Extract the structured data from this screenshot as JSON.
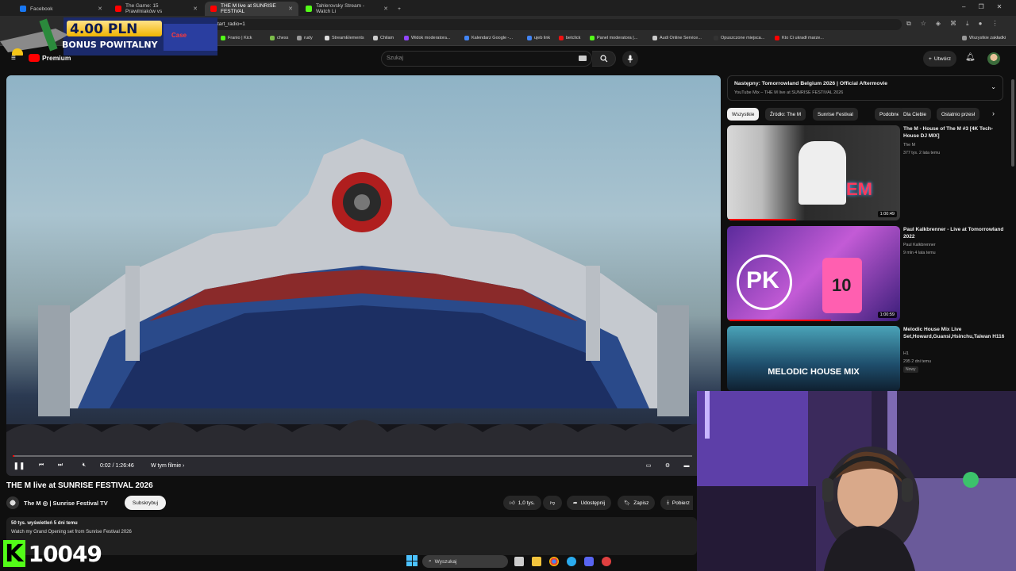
{
  "browser": {
    "tabs": [
      {
        "label": "Facebook",
        "favicon_color": "#1877f2"
      },
      {
        "label": "The Game: 15 Prawilniaków vs",
        "favicon_color": "#ff0000"
      },
      {
        "label": "THE M live at SUNRISE FESTIVAL",
        "favicon_color": "#ff0000"
      },
      {
        "label": "Tahlerovsky Stream - Watch Li",
        "favicon_color": "#53fc18"
      }
    ],
    "new_tab_label": "+",
    "address": "tart_radio=1",
    "bookmarks": [
      {
        "label": "Franio | Kick",
        "color": "#53fc18"
      },
      {
        "label": "chess",
        "color": "#7cbd4a"
      },
      {
        "label": "rudy",
        "color": "#999999"
      },
      {
        "label": "StreamElements",
        "color": "#dddddd"
      },
      {
        "label": "Chilam",
        "color": "#cccccc"
      },
      {
        "label": "Widok moderatora...",
        "color": "#9146ff"
      },
      {
        "label": "Kalendarz Google -...",
        "color": "#4285f4"
      },
      {
        "label": "ujeb link",
        "color": "#4285f4"
      },
      {
        "label": "betclick",
        "color": "#e11"
      },
      {
        "label": "Panel moderatora |...",
        "color": "#53fc18"
      },
      {
        "label": "Audi Online Service...",
        "color": "#cccccc"
      },
      {
        "label": "Opuszczone miejsca...",
        "color": "#333333"
      },
      {
        "label": "Kto Ci ukradł marze...",
        "color": "#ff0000"
      }
    ],
    "all_bookmarks": "Wszystkie zakładki"
  },
  "promo": {
    "amount": "4.00 PLN",
    "subtitle": "BONUS POWITALNY",
    "brand": "Case"
  },
  "youtube": {
    "logo_text": "Premium",
    "search_placeholder": "Szukaj",
    "create_label": "Utwórz"
  },
  "player": {
    "time": "0:02 / 1:26:46",
    "chapter": "W tym filmie",
    "progress": 0.0004
  },
  "video": {
    "title": "THE M live at SUNRISE FESTIVAL 2026",
    "channel": "The M ◎ | Sunrise Festival TV",
    "subscribe": "Subskrybuj",
    "likes": "1,0 tys.",
    "share": "Udostępnij",
    "save": "Zapisz",
    "download": "Pobierz",
    "views": "50 tys. wyświetleń  5 dni temu",
    "description": "Watch my Grand Opening set from Sunrise Festival 2026"
  },
  "sidebar": {
    "next_label": "Następny:",
    "next_title": "Tomorrowland Belgium 2026 | Official Aftermovie",
    "next_sub": "YouTube Mix – THE M live at SUNRISE FESTIVAL 2026",
    "chips": [
      "Wszystkie",
      "Źródło: The M",
      "Sunrise Festival",
      "Podobne",
      "Dla Ciebie",
      "Ostatnio przesł"
    ],
    "recs": [
      {
        "title": "The M - House of The M #3 [4K Tech-House DJ MIX]",
        "channel": "The M",
        "meta": "377 tys.  2 lata temu",
        "duration": "1:00:49"
      },
      {
        "title": "Paul Kalkbrenner - Live at Tomorrowland 2022",
        "channel": "Paul Kalkbrenner",
        "meta": "9 mln  4 lata temu",
        "duration": "1:00:59"
      },
      {
        "title": "Melodic House Mix Live Set,Howard,Guansi,Hsinchu,Taiwan H116",
        "channel": "H1",
        "meta": "295  2 dni temu",
        "badge": "Nowy",
        "thumb_text": "MELODIC HOUSE MIX"
      }
    ]
  },
  "kick": {
    "logo": "K",
    "count": "10049"
  },
  "taskbar": {
    "search": "Wyszukaj"
  },
  "colors": {
    "accent": "#ff0000",
    "kick_green": "#53fc18",
    "bg": "#0f0f0f"
  }
}
